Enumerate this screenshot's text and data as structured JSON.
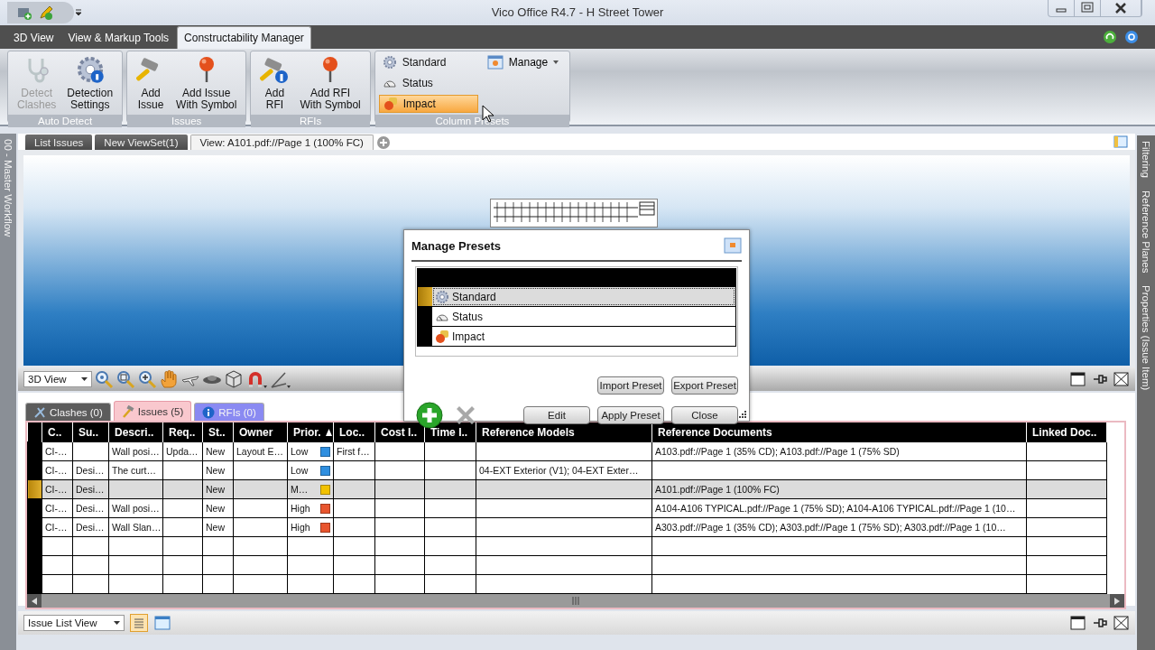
{
  "window": {
    "title": "Vico Office R4.7 - H Street Tower"
  },
  "ribbon": {
    "tabs": [
      {
        "label": "3D View",
        "selected": false
      },
      {
        "label": "View & Markup Tools",
        "selected": false
      },
      {
        "label": "Constructability Manager",
        "selected": true
      }
    ],
    "groups": [
      {
        "label": "Auto Detect",
        "buttons": [
          {
            "label": "Detect\nClashes",
            "disabled": true
          },
          {
            "label": "Detection\nSettings",
            "disabled": false
          }
        ]
      },
      {
        "label": "Issues",
        "buttons": [
          {
            "label": "Add\nIssue",
            "disabled": false
          },
          {
            "label": "Add Issue\nWith Symbol",
            "disabled": false
          }
        ]
      },
      {
        "label": "RFIs",
        "buttons": [
          {
            "label": "Add\nRFI",
            "disabled": false
          },
          {
            "label": "Add RFI\nWith Symbol",
            "disabled": false
          }
        ]
      }
    ],
    "column_presets": {
      "label": "Column Presets",
      "manage": "Manage",
      "items": [
        {
          "label": "Standard",
          "selected": false
        },
        {
          "label": "Status",
          "selected": false
        },
        {
          "label": "Impact",
          "selected": true
        }
      ]
    }
  },
  "side_left": [
    "00 - Master Workflow"
  ],
  "side_right": [
    "Filtering",
    "Reference Planes",
    "Properties (Issue Item)"
  ],
  "document_tabs": [
    {
      "label": "List Issues",
      "selected": false
    },
    {
      "label": "New ViewSet(1)",
      "selected": false
    },
    {
      "label": "View: A101.pdf://Page 1 (100% FC)",
      "selected": true
    }
  ],
  "view_toolbar": {
    "view_select": "3D View"
  },
  "issue_tabs": [
    {
      "label": "Clashes (0)",
      "selected": false,
      "color": "#5c5c5c"
    },
    {
      "label": "Issues (5)",
      "selected": true,
      "color": "#f9c8ce"
    },
    {
      "label": "RFIs (0)",
      "selected": false,
      "color": "#8a8af2"
    }
  ],
  "issue_table": {
    "columns": [
      {
        "label": "C..",
        "sorted": false
      },
      {
        "label": "Su..",
        "sorted": false
      },
      {
        "label": "Descri..",
        "sorted": false
      },
      {
        "label": "Req..",
        "sorted": false
      },
      {
        "label": "St..",
        "sorted": false
      },
      {
        "label": "Owner",
        "sorted": false
      },
      {
        "label": "Prior.",
        "sorted": true
      },
      {
        "label": "Loc..",
        "sorted": false
      },
      {
        "label": "Cost I..",
        "sorted": false
      },
      {
        "label": "Time I..",
        "sorted": false
      },
      {
        "label": "Reference Models",
        "sorted": false
      },
      {
        "label": "Reference Documents",
        "sorted": false
      },
      {
        "label": "Linked Doc..",
        "sorted": false
      }
    ],
    "rows": [
      {
        "selected": false,
        "color": "#2f8fe0",
        "cells": [
          "CI-…",
          null,
          "Wall posi…",
          "Upda…",
          "New",
          "Layout E…",
          "Low",
          "First f…",
          null,
          null,
          null,
          "A103.pdf://Page 1 (35% CD); A103.pdf://Page 1 (75% SD)",
          null
        ]
      },
      {
        "selected": false,
        "color": "#2f8fe0",
        "cells": [
          "CI-…",
          "Desi…",
          "The curt…",
          null,
          "New",
          null,
          "Low",
          null,
          null,
          null,
          "04-EXT Exterior (V1); 04-EXT Exter…",
          null,
          null
        ]
      },
      {
        "selected": true,
        "color": "#f2c200",
        "cells": [
          "CI-…",
          "Desi…",
          null,
          null,
          "New",
          null,
          "M…",
          null,
          null,
          null,
          null,
          "A101.pdf://Page 1 (100% FC)",
          null
        ]
      },
      {
        "selected": false,
        "color": "#e8552e",
        "cells": [
          "CI-…",
          "Desi…",
          "Wall posi…",
          null,
          "New",
          null,
          "High",
          null,
          null,
          null,
          null,
          "A104-A106 TYPICAL.pdf://Page 1 (75% SD); A104-A106 TYPICAL.pdf://Page 1 (10…",
          null
        ]
      },
      {
        "selected": false,
        "color": "#e8552e",
        "cells": [
          "CI-…",
          "Desi…",
          "Wall Slan…",
          null,
          "New",
          null,
          "High",
          null,
          null,
          null,
          null,
          "A303.pdf://Page 1 (35% CD); A303.pdf://Page 1 (75% SD); A303.pdf://Page 1 (10…",
          null
        ]
      }
    ]
  },
  "bottom_bar": {
    "view_select": "Issue List View"
  },
  "dialog": {
    "title": "Manage Presets",
    "presets": [
      {
        "label": "Standard",
        "selected": true
      },
      {
        "label": "Status",
        "selected": false
      },
      {
        "label": "Impact",
        "selected": false
      }
    ],
    "delete_disabled": true,
    "buttons": [
      "Import Preset",
      "Export Preset",
      "Edit",
      "Apply Preset",
      "Close"
    ]
  }
}
